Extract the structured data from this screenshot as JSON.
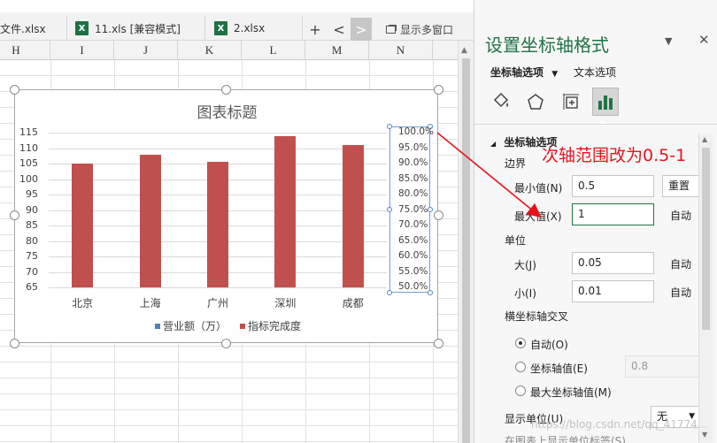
{
  "tabs": [
    {
      "label": "文件.xlsx"
    },
    {
      "label": "11.xls  [兼容模式]"
    },
    {
      "label": "2.xlsx"
    }
  ],
  "tabbar": {
    "add": "+",
    "prev": "<",
    "next": ">",
    "multi_window": "显示多窗口"
  },
  "columns": [
    "H",
    "I",
    "J",
    "K",
    "L",
    "M",
    "N"
  ],
  "chart_data": {
    "type": "bar",
    "title": "图表标题",
    "categories": [
      "北京",
      "上海",
      "广州",
      "深圳",
      "成都"
    ],
    "series": [
      {
        "name": "营业额（万）",
        "values": [
          null,
          null,
          null,
          null,
          null
        ],
        "color": "#4f81bd"
      },
      {
        "name": "指标完成度",
        "values": [
          0.9,
          0.93,
          0.905,
          0.99,
          0.96
        ],
        "color": "#c0504d",
        "axis": "secondary"
      }
    ],
    "y_ticks": [
      "115",
      "110",
      "105",
      "100",
      "95",
      "90",
      "85",
      "80",
      "75",
      "70",
      "65"
    ],
    "y2_ticks": [
      "100.0%",
      "95.0%",
      "90.0%",
      "85.0%",
      "80.0%",
      "75.0%",
      "70.0%",
      "65.0%",
      "60.0%",
      "55.0%",
      "50.0%"
    ],
    "ylim": [
      65,
      115
    ],
    "y2lim": [
      0.5,
      1.0
    ],
    "legend_position": "bottom",
    "grid": true
  },
  "pane": {
    "title": "设置坐标轴格式",
    "tab_axis": "坐标轴选项",
    "tab_text": "文本选项",
    "section_axis": "坐标轴选项",
    "bounds": "边界",
    "min_label": "最小值(N)",
    "min_value": "0.5",
    "reset": "重置",
    "max_label": "最大值(X)",
    "max_value": "1",
    "auto": "自动",
    "units": "单位",
    "major_label": "大(J)",
    "major_value": "0.05",
    "minor_label": "小(I)",
    "minor_value": "0.01",
    "cross": "横坐标轴交叉",
    "cross_auto": "自动(O)",
    "cross_value_label": "坐标轴值(E)",
    "cross_value": "0.8",
    "cross_max": "最大坐标轴值(M)",
    "display_units": "显示单位(U)",
    "display_units_value": "无",
    "show_units_label": "在图表上显示单位标签(S)"
  },
  "annotation": "次轴范围改为0.5-1",
  "watermark": "https://blog.csdn.net/qq_41774..."
}
